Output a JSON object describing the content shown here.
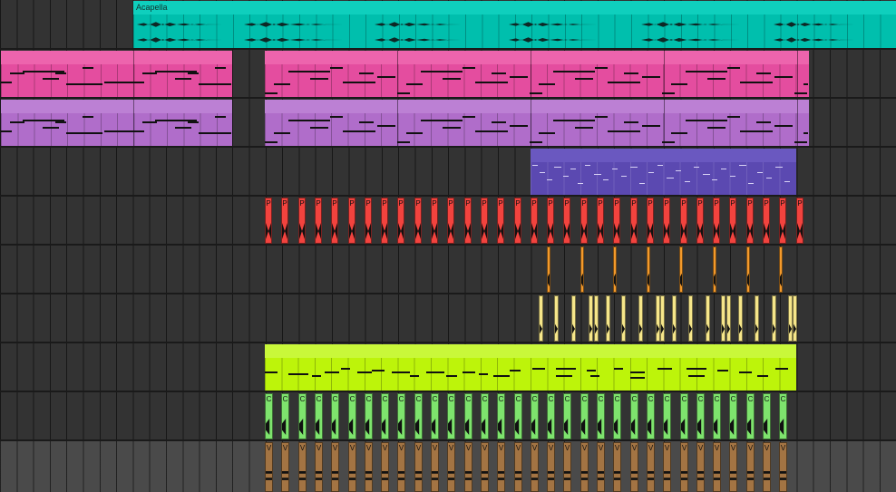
{
  "window": {
    "view": "arrangement"
  },
  "tracks": [
    {
      "id": "acapella",
      "clip_name": "Acapella",
      "color": "#00bfad",
      "kind": "audio"
    },
    {
      "id": "pink-midi",
      "clip_name": "",
      "color": "#e44d9f",
      "kind": "midi"
    },
    {
      "id": "purple-midi",
      "clip_name": "",
      "color": "#b06dca",
      "kind": "midi"
    },
    {
      "id": "indigo-midi",
      "clip_name": "",
      "color": "#5b49b1",
      "kind": "midi"
    },
    {
      "id": "red-slices",
      "clip_name": "",
      "color": "#f2433e",
      "kind": "drum",
      "slice_label": "P"
    },
    {
      "id": "orange-hits",
      "clip_name": "",
      "color": "#f49a2b",
      "kind": "drum"
    },
    {
      "id": "yellow-hits",
      "clip_name": "",
      "color": "#f6e68a",
      "kind": "drum"
    },
    {
      "id": "lime-midi",
      "clip_name": "",
      "color": "#bdf40a",
      "kind": "midi"
    },
    {
      "id": "green-slices",
      "clip_name": "",
      "color": "#7ee36d",
      "kind": "drum",
      "slice_label": "C"
    },
    {
      "id": "brown-slices",
      "clip_name": "",
      "color": "#a37443",
      "kind": "drum",
      "slice_label": "V"
    }
  ]
}
